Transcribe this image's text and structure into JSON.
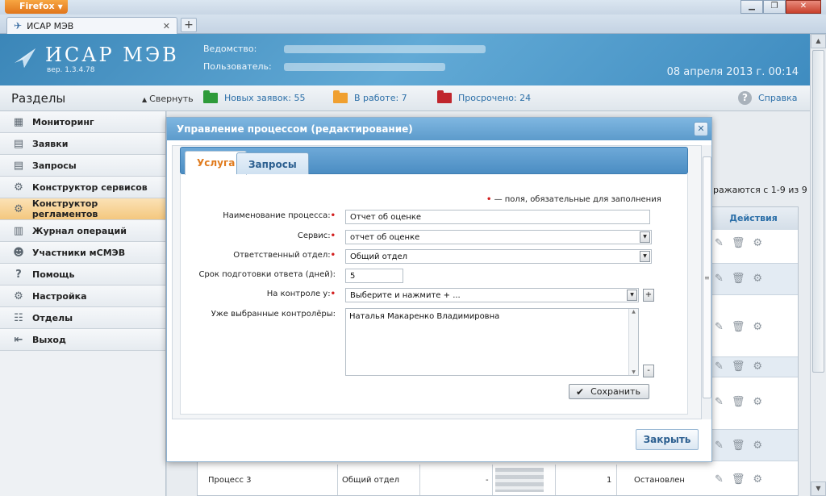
{
  "browser": {
    "app_button": "Firefox",
    "tab_title": "ИСАР МЭВ",
    "new_tab": "+"
  },
  "header": {
    "logo_title": "ИСАР МЭВ",
    "version": "вер. 1.3.4.78",
    "agency_label": "Ведомство:",
    "user_label": "Пользователь:",
    "datetime": "08 апреля 2013 г.   00:14"
  },
  "toolbar": {
    "sections_title": "Разделы",
    "collapse_label": "Свернуть",
    "new_requests": "Новых заявок: 55",
    "in_progress": "В работе: 7",
    "overdue": "Просрочено: 24",
    "help": "Справка"
  },
  "sidebar": {
    "items": [
      {
        "label": "Мониторинг",
        "icon": "monitor-icon"
      },
      {
        "label": "Заявки",
        "icon": "requests-icon"
      },
      {
        "label": "Запросы",
        "icon": "queries-icon"
      },
      {
        "label": "Конструктор сервисов",
        "icon": "gear-icon"
      },
      {
        "label": "Конструктор регламентов",
        "icon": "gear-icon"
      },
      {
        "label": "Журнал операций",
        "icon": "book-icon"
      },
      {
        "label": "Участники мСМЭВ",
        "icon": "users-icon"
      },
      {
        "label": "Помощь",
        "icon": "help-icon"
      },
      {
        "label": "Настройка",
        "icon": "settings-icon"
      },
      {
        "label": "Отделы",
        "icon": "departments-icon"
      },
      {
        "label": "Выход",
        "icon": "exit-icon"
      }
    ]
  },
  "grid": {
    "range_text": "ражаются с 1-9 из 9",
    "actions_header": "Действия",
    "last_row": {
      "name": "Процесс 3",
      "department": "Общий отдел",
      "dash": "-",
      "count": "1",
      "status": "Остановлен"
    }
  },
  "modal": {
    "title": "Управление процессом (редактирование)",
    "tabs": [
      "Услуга",
      "Запросы"
    ],
    "required_note": "— поля, обязательные для заполнения",
    "fields": {
      "name_label": "Наименование процесса:",
      "name_value": "Отчет об оценке",
      "service_label": "Сервис:",
      "service_value": "отчет об оценке",
      "department_label": "Ответственный отдел:",
      "department_value": "Общий отдел",
      "deadline_label": "Срок подготовки ответа (дней):",
      "deadline_value": "5",
      "control_label": "На контроле у:",
      "control_value": "Выберите и нажмите + ...",
      "selected_label": "Уже выбранные контролёры:",
      "selected_value": "Наталья Макаренко Владимировна"
    },
    "save_button": "Сохранить",
    "close_button": "Закрыть",
    "plus": "+",
    "minus": "-"
  },
  "colors": {
    "accent": "#4b8dc3",
    "active_tab_text": "#e07b1e",
    "required": "#d32020",
    "folder_new": "#2e9b3a",
    "folder_progress": "#f0a030",
    "folder_overdue": "#c0262d"
  }
}
